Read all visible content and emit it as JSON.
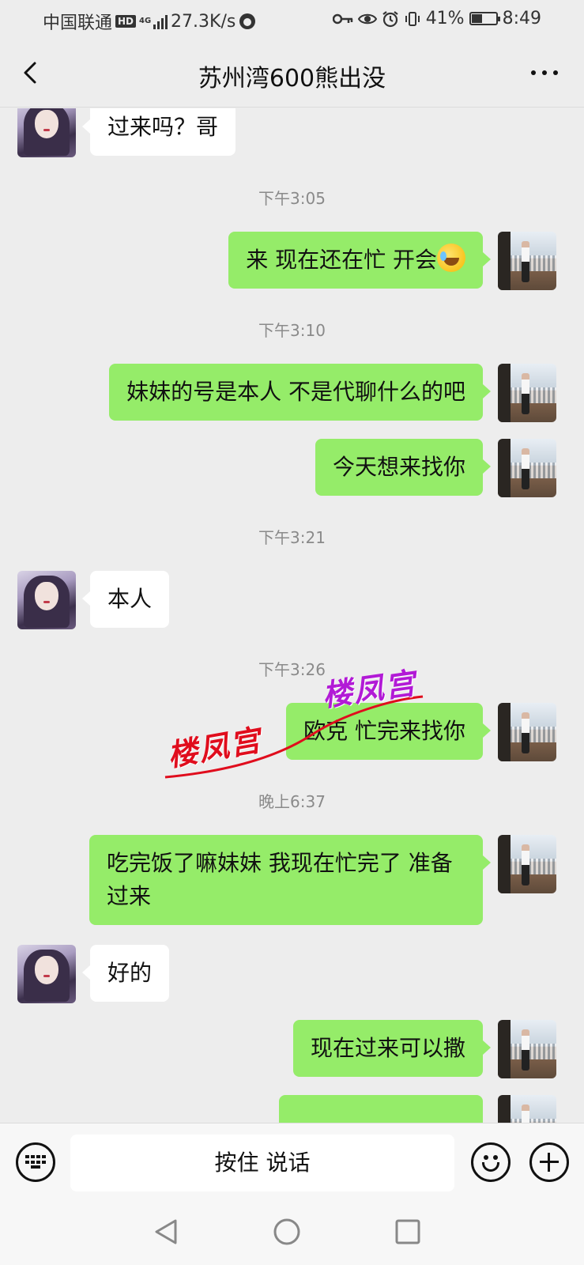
{
  "status_bar": {
    "carrier": "中国联通",
    "hd": "HD",
    "network": "4G",
    "speed": "27.3K/s",
    "battery_percent": "41%",
    "battery_level": 0.41,
    "time": "8:49"
  },
  "header": {
    "title": "苏州湾600熊出没",
    "back_icon": "back-arrow-icon",
    "more_icon": "more-dots-icon"
  },
  "messages": [
    {
      "side": "in",
      "text": "过来吗？哥"
    },
    {
      "time": "下午3:05"
    },
    {
      "side": "out",
      "text": "来 现在还在忙 开会"
    },
    {
      "time": "下午3:10"
    },
    {
      "side": "out",
      "text": "妹妹的号是本人 不是代聊什么的吧"
    },
    {
      "side": "out",
      "text": "今天想来找你"
    },
    {
      "time": "下午3:21"
    },
    {
      "side": "in",
      "text": "本人"
    },
    {
      "time": "下午3:26"
    },
    {
      "side": "out",
      "text": "欧克 忙完来找你"
    },
    {
      "time": "晚上6:37"
    },
    {
      "side": "out",
      "text": "吃完饭了嘛妹妹 我现在忙完了 准备过来"
    },
    {
      "side": "in",
      "text": "好的"
    },
    {
      "side": "out",
      "text": "现在过来可以撒"
    }
  ],
  "watermark": {
    "text_red": "楼凤宫",
    "text_purple": "楼凤宫"
  },
  "input_bar": {
    "voice_label": "按住 说话",
    "keyboard_icon": "keyboard-icon",
    "emoji_icon": "emoji-icon",
    "plus_icon": "plus-icon"
  },
  "colors": {
    "background": "#ededed",
    "outgoing_bubble": "#95ec69",
    "incoming_bubble": "#ffffff",
    "timestamp": "#8a8a8a",
    "watermark_red": "#e00d1d",
    "watermark_purple": "#b21ad6"
  }
}
